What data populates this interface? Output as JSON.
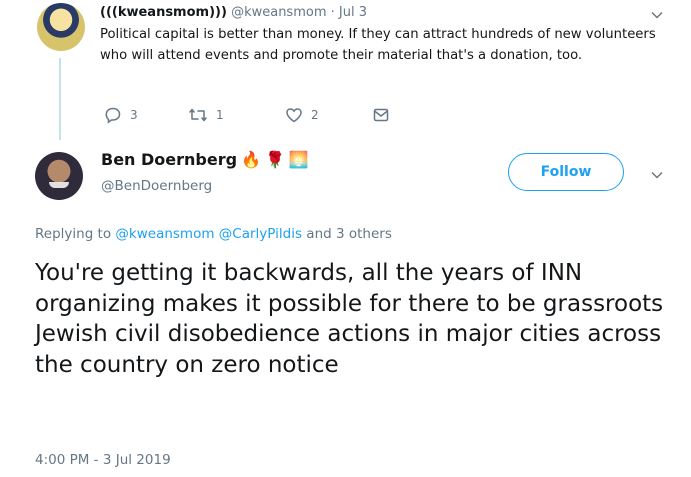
{
  "parent_tweet": {
    "display_name": "(((kweansmom)))",
    "handle": "@kweansmom",
    "separator": "·",
    "date": "Jul 3",
    "text": "Political capital is better than money. If they can attract hundreds of new volunteers who will attend events and promote their material that's a donation, too.",
    "actions": {
      "reply_count": "3",
      "retweet_count": "1",
      "like_count": "2"
    }
  },
  "tweet": {
    "display_name": "Ben Doernberg",
    "name_emojis": [
      "🔥",
      "🌹",
      "🌅"
    ],
    "handle": "@BenDoernberg",
    "follow_label": "Follow",
    "replying_prefix": "Replying to",
    "replying_user1": "@kweansmom",
    "replying_user2": "@CarlyPildis",
    "replying_suffix": "and 3 others",
    "text": "You're getting it backwards, all the years of INN organizing makes it possible for there to be grassroots Jewish civil disobedience actions in major cities across the country on zero notice",
    "timestamp": "4:00 PM - 3 Jul 2019"
  },
  "colors": {
    "accent": "#1da1f2",
    "muted_text": "#657786",
    "body_text": "#14171a",
    "thread_line": "#c3e3ec"
  }
}
